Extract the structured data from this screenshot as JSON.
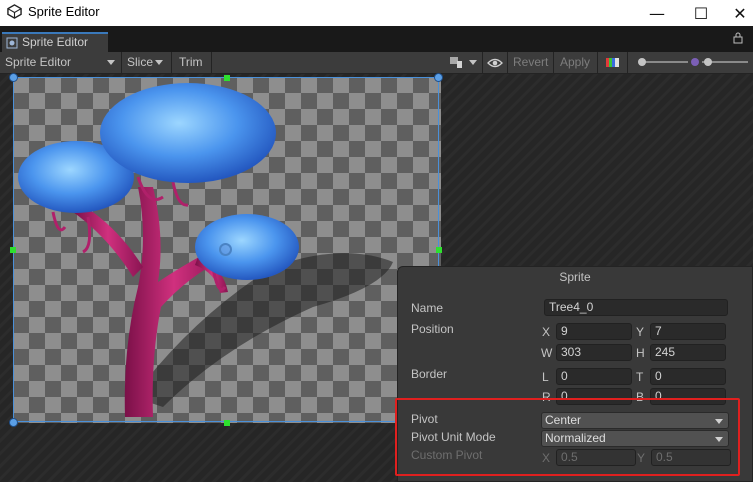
{
  "window": {
    "title": "Sprite Editor",
    "minimize": "—",
    "maximize": "☐",
    "close": "✕"
  },
  "tab": {
    "label": "Sprite Editor"
  },
  "toolbar": {
    "mode_dropdown": "Sprite Editor",
    "slice": "Slice",
    "trim": "Trim",
    "revert": "Revert",
    "apply": "Apply"
  },
  "sprite_panel": {
    "title": "Sprite",
    "name_label": "Name",
    "name_value": "Tree4_0",
    "position_label": "Position",
    "x_label": "X",
    "x_value": "9",
    "y_label": "Y",
    "y_value": "7",
    "w_label": "W",
    "w_value": "303",
    "h_label": "H",
    "h_value": "245",
    "border_label": "Border",
    "l_label": "L",
    "l_value": "0",
    "t_label": "T",
    "t_value": "0",
    "r_label": "R",
    "r_value": "0",
    "b_label": "B",
    "b_value": "0",
    "pivot_label": "Pivot",
    "pivot_value": "Center",
    "pivot_unit_label": "Pivot Unit Mode",
    "pivot_unit_value": "Normalized",
    "custom_pivot_label": "Custom Pivot",
    "cx_label": "X",
    "cx_value": "0.5",
    "cy_label": "Y",
    "cy_value": "0.5"
  },
  "colors": {
    "accent": "#3a79bb",
    "highlight_box": "#e0201f",
    "sprite_leaves": "#3d7fe0",
    "sprite_trunk": "#b0206a"
  },
  "icons": [
    "unity-logo-icon",
    "sprite-editor-tab-icon",
    "lock-icon",
    "brush-icon",
    "eye-icon",
    "color-channel-icon",
    "zoom-slider-icon",
    "mip-slider-icon"
  ]
}
